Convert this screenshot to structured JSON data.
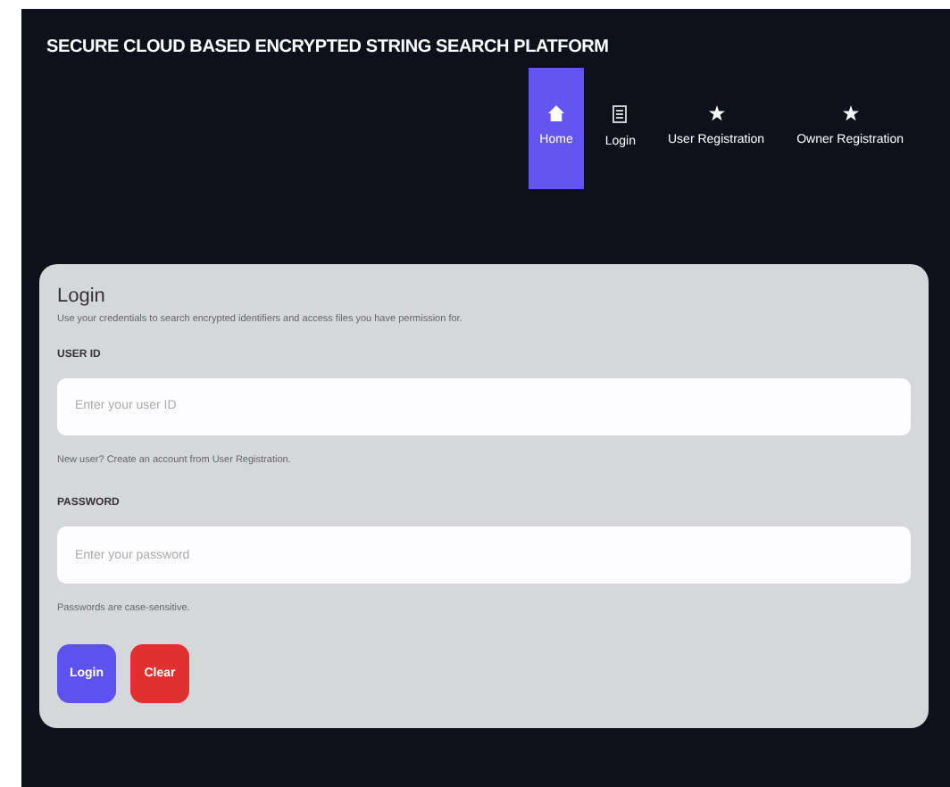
{
  "header": {
    "title": "SECURE CLOUD BASED ENCRYPTED STRING SEARCH PLATFORM"
  },
  "nav": [
    {
      "label": "Home",
      "kind": "home",
      "selected": true
    },
    {
      "label": "Login",
      "kind": "doc",
      "selected": false
    },
    {
      "label": "User Registration",
      "kind": "star",
      "selected": false
    },
    {
      "label": "Owner Registration",
      "kind": "star",
      "selected": false
    }
  ],
  "form": {
    "title": "Login",
    "subtitle": "Use your credentials to search encrypted identifiers and access files you have permission for.",
    "fields": [
      {
        "label": "USER ID",
        "placeholder": "Enter your user ID",
        "help": "New user? Create an account from User Registration."
      },
      {
        "label": "PASSWORD",
        "placeholder": "Enter your password",
        "help": "Passwords are case-sensitive."
      }
    ],
    "buttons": [
      {
        "label": "Login",
        "kind": "primary"
      },
      {
        "label": "Clear",
        "kind": "danger"
      }
    ]
  }
}
